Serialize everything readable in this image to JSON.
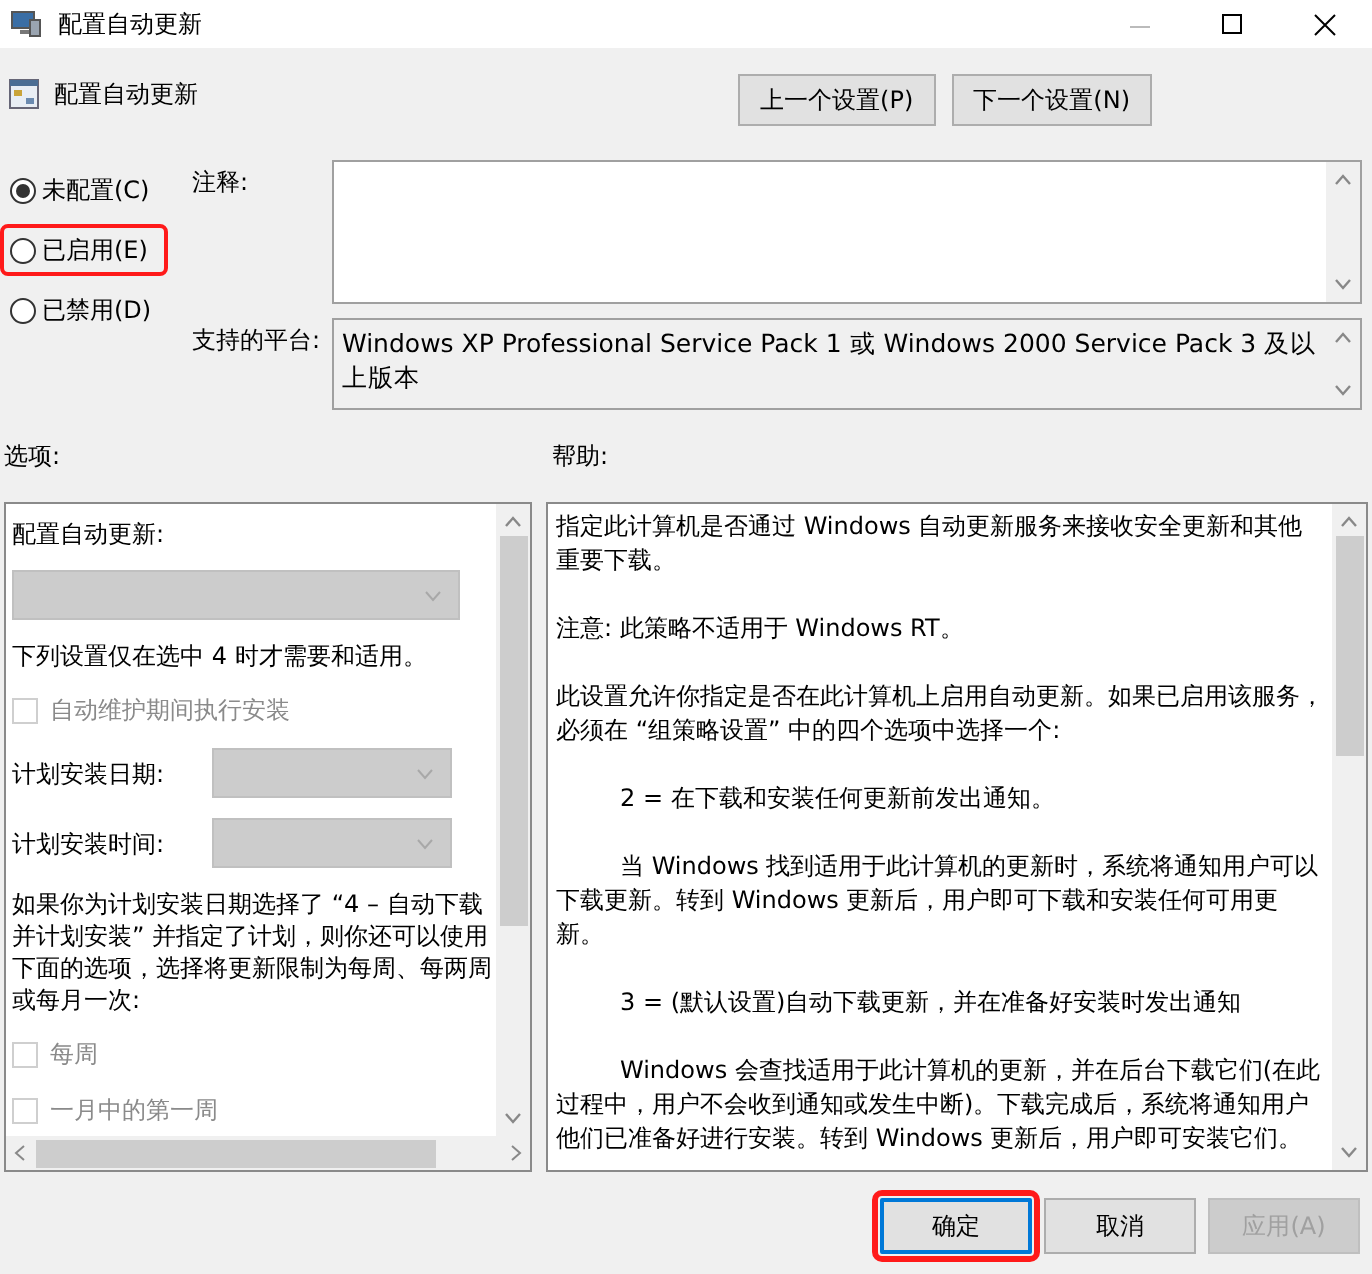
{
  "window": {
    "title": "配置自动更新"
  },
  "header": {
    "title": "配置自动更新",
    "buttons": [
      {
        "label": "上一个设置(P)"
      },
      {
        "label": "下一个设置(N)"
      }
    ]
  },
  "state_options": [
    {
      "label": "未配置(C)",
      "selected": true,
      "highlighted": false
    },
    {
      "label": "已启用(E)",
      "selected": false,
      "highlighted": true
    },
    {
      "label": "已禁用(D)",
      "selected": false,
      "highlighted": false
    }
  ],
  "comment": {
    "label": "注释:"
  },
  "platform": {
    "label": "支持的平台:",
    "value": "Windows XP Professional Service Pack 1 或 Windows 2000 Service Pack 3 及以上版本"
  },
  "options": {
    "label": "选项:",
    "items": [
      {
        "kind": "label",
        "text": "配置自动更新:"
      },
      {
        "kind": "dropdown"
      },
      {
        "kind": "label",
        "text": "下列设置仅在选中 4 时才需要和适用。"
      },
      {
        "kind": "checkbox",
        "text": "自动维护期间执行安装",
        "checked": false
      },
      {
        "kind": "field",
        "text": "计划安装日期:"
      },
      {
        "kind": "field",
        "text": "计划安装时间:"
      },
      {
        "kind": "label",
        "text": "如果你为计划安装日期选择了 “4 – 自动下载并计划安装” 并指定了计划，则你还可以使用下面的选项，选择将更新限制为每周、每两周或每月一次:"
      },
      {
        "kind": "checkbox",
        "text": "每周",
        "checked": false
      },
      {
        "kind": "checkbox",
        "text": "一月中的第一周",
        "checked": false
      }
    ]
  },
  "help": {
    "label": "帮助:",
    "paragraphs": [
      {
        "text": "指定此计算机是否通过 Windows 自动更新服务来接收安全更新和其他重要下载。",
        "indent": false
      },
      {
        "text": "注意: 此策略不适用于 Windows RT。",
        "indent": false
      },
      {
        "text": "此设置允许你指定是否在此计算机上启用自动更新。如果已启用该服务，必须在 “组策略设置” 中的四个选项中选择一个:",
        "indent": false
      },
      {
        "text": "2 = 在下载和安装任何更新前发出通知。",
        "indent": true
      },
      {
        "text": "当 Windows 找到适用于此计算机的更新时，系统将通知用户可以下载更新。转到 Windows 更新后，用户即可下载和安装任何可用更新。",
        "indent": true
      },
      {
        "text": "3 = (默认设置)自动下载更新，并在准备好安装时发出通知",
        "indent": true
      },
      {
        "text": "Windows 会查找适用于此计算机的更新，并在后台下载它们(在此过程中，用户不会收到通知或发生中断)。下载完成后，系统将通知用户他们已准备好进行安装。转到 Windows 更新后，用户即可安装它们。",
        "indent": true
      }
    ]
  },
  "footer": [
    {
      "label": "确定",
      "disabled": false,
      "highlighted": true,
      "focused": true
    },
    {
      "label": "取消",
      "disabled": false,
      "highlighted": false,
      "focused": false
    },
    {
      "label": "应用(A)",
      "disabled": true,
      "highlighted": false,
      "focused": false
    }
  ]
}
